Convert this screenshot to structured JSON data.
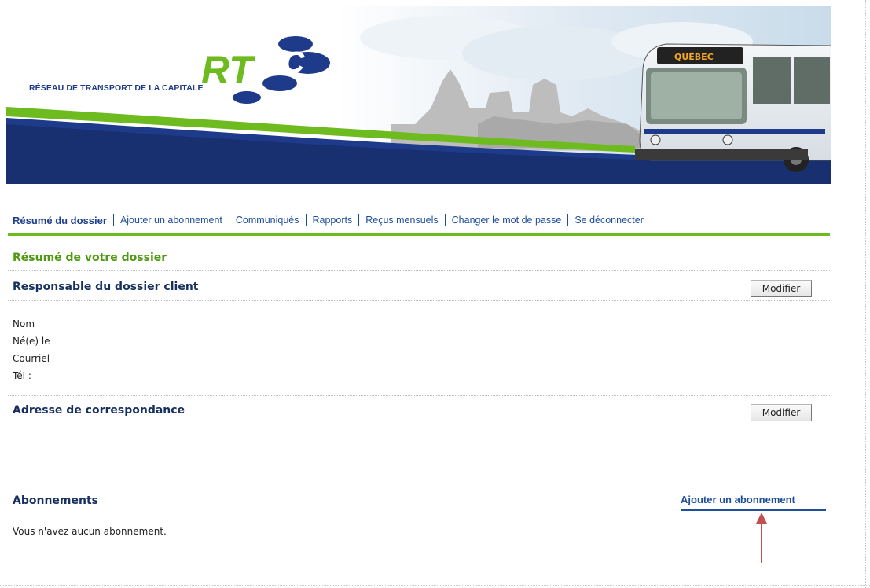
{
  "banner": {
    "logo_letters": "RTC",
    "logo_subtitle": "RÉSEAU DE TRANSPORT DE LA CAPITALE",
    "bus_sign": "QUÉBEC",
    "colors": {
      "navy": "#1e3a8a",
      "green": "#6dbb1e"
    }
  },
  "nav": {
    "items": [
      {
        "label": "Résumé du dossier",
        "active": true
      },
      {
        "label": "Ajouter un abonnement"
      },
      {
        "label": "Communiqués"
      },
      {
        "label": "Rapports"
      },
      {
        "label": "Reçus mensuels"
      },
      {
        "label": "Changer le mot de passe"
      },
      {
        "label": "Se déconnecter"
      }
    ]
  },
  "main": {
    "page_title": "Résumé de votre dossier",
    "client": {
      "title": "Responsable du dossier client",
      "modify_label": "Modifier",
      "fields": [
        "Nom",
        "Né(e) le",
        "Courriel",
        "Tél :"
      ]
    },
    "address": {
      "title": "Adresse de correspondance",
      "modify_label": "Modifier"
    },
    "subscriptions": {
      "title": "Abonnements",
      "add_link": "Ajouter un abonnement",
      "empty_message": "Vous n'avez aucun abonnement."
    }
  },
  "annotation": {
    "arrow_color": "#c0504d"
  }
}
